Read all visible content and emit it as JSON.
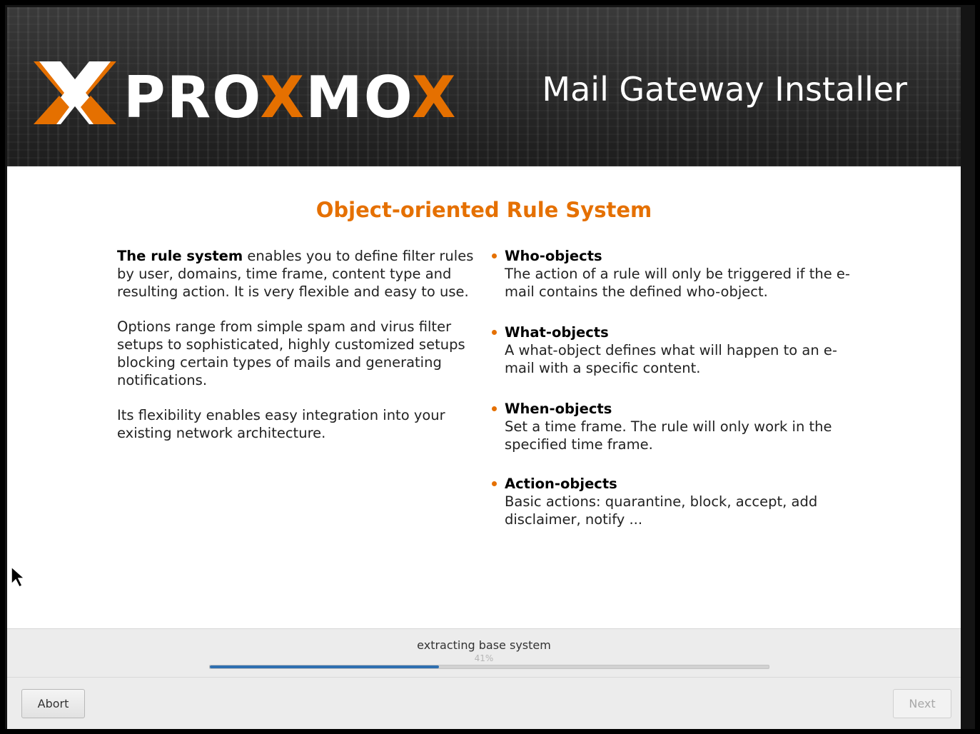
{
  "header": {
    "logo_text": "PROXMOX",
    "installer_title": "Mail Gateway Installer"
  },
  "content": {
    "title": "Object-oriented Rule System",
    "intro_bold": "The rule system",
    "intro_rest": " enables you to define filter rules by user, domains, time frame, content type and resulting action. It is very flexible and easy to use.",
    "paragraph2": "Options range from simple spam and virus filter setups to sophisticated, highly customized setups blocking certain types of mails and generating notifications.",
    "paragraph3": "Its flexibility enables easy integration into your existing network architecture.",
    "bullets": [
      {
        "title": "Who-objects",
        "text": "The action of a rule will only be triggered if the e-mail contains the defined who-object."
      },
      {
        "title": "What-objects",
        "text": "A what-object defines what will happen to an e-mail with a specific content."
      },
      {
        "title": "When-objects",
        "text": "Set a time frame. The rule will only work in the specified time frame."
      },
      {
        "title": "Action-objects",
        "text": "Basic actions: quarantine, block, accept, add disclaimer, notify ..."
      }
    ]
  },
  "progress": {
    "status": "extracting base system",
    "percent_label": "41%",
    "value": 0.41
  },
  "buttons": {
    "abort": "Abort",
    "next": "Next"
  },
  "colors": {
    "accent": "#e57000",
    "progress": "#2f6fb0"
  }
}
